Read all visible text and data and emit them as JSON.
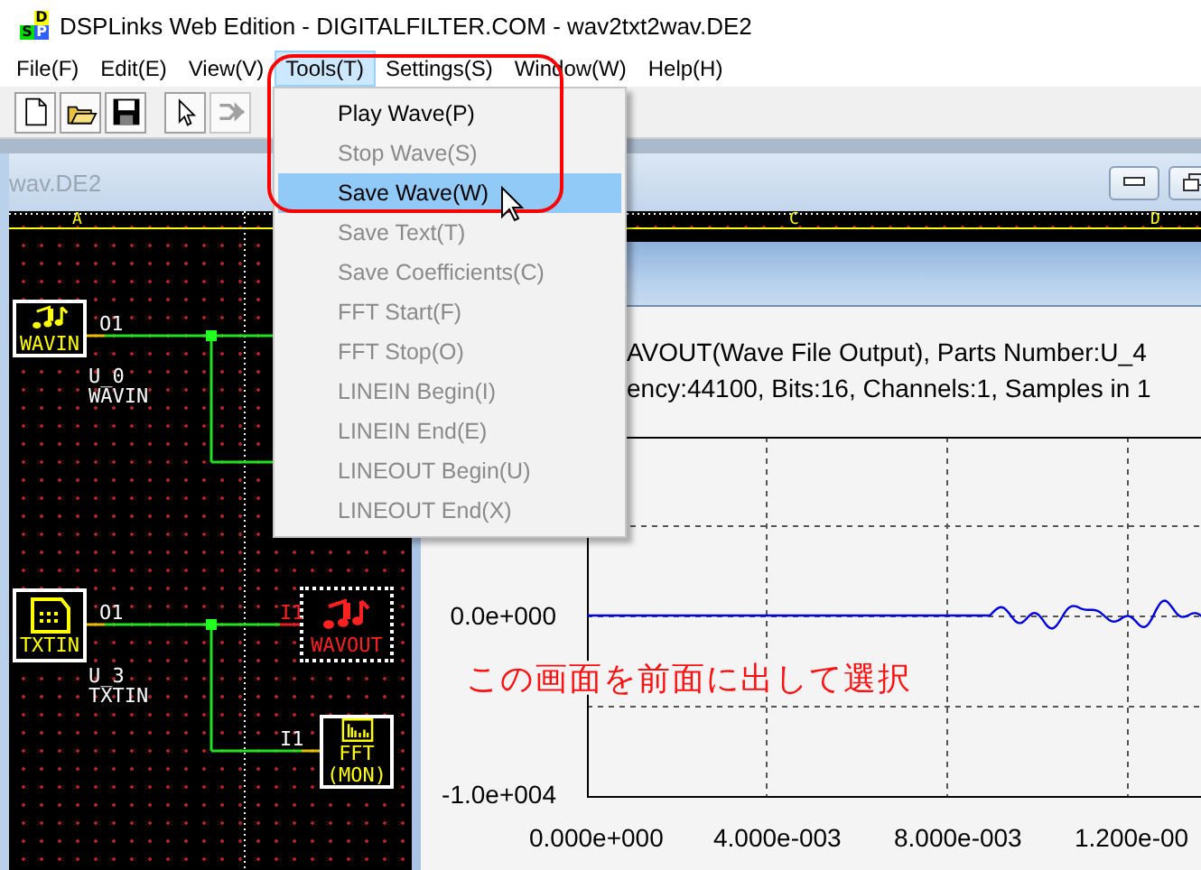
{
  "window": {
    "title": "DSPLinks Web Edition - DIGITALFILTER.COM - wav2txt2wav.DE2",
    "logo_letters": [
      "D",
      "S",
      "P"
    ]
  },
  "menu": [
    {
      "label": "File(F)",
      "selected": false
    },
    {
      "label": "Edit(E)",
      "selected": false
    },
    {
      "label": "View(V)",
      "selected": false
    },
    {
      "label": "Tools(T)",
      "selected": true
    },
    {
      "label": "Settings(S)",
      "selected": false
    },
    {
      "label": "Window(W)",
      "selected": false
    },
    {
      "label": "Help(H)",
      "selected": false
    }
  ],
  "toolbar": [
    {
      "kind": "new",
      "disabled": false
    },
    {
      "kind": "open",
      "disabled": false
    },
    {
      "kind": "save",
      "disabled": false
    },
    {
      "kind": "pointer",
      "disabled": false
    },
    {
      "kind": "wire",
      "disabled": true
    }
  ],
  "tools_menu": [
    {
      "label": "Play Wave(P)",
      "disabled": false,
      "selected": false
    },
    {
      "label": "Stop Wave(S)",
      "disabled": true,
      "selected": false
    },
    {
      "label": "Save Wave(W)",
      "disabled": false,
      "selected": true
    },
    {
      "label": "Save Text(T)",
      "disabled": true,
      "selected": false
    },
    {
      "label": "Save Coefficients(C)",
      "disabled": true,
      "selected": false
    },
    {
      "label": "FFT Start(F)",
      "disabled": true,
      "selected": false
    },
    {
      "label": "FFT Stop(O)",
      "disabled": true,
      "selected": false
    },
    {
      "label": "LINEIN Begin(I)",
      "disabled": true,
      "selected": false
    },
    {
      "label": "LINEIN End(E)",
      "disabled": true,
      "selected": false
    },
    {
      "label": "LINEOUT Begin(U)",
      "disabled": true,
      "selected": false
    },
    {
      "label": "LINEOUT End(X)",
      "disabled": true,
      "selected": false
    }
  ],
  "schematic": {
    "title": "wav.DE2",
    "columns": [
      "A",
      "C",
      "D"
    ],
    "parts": [
      {
        "kind": "wavin",
        "label": "WAVIN",
        "port": "O1",
        "id_label": "U_0",
        "name_label": "WAVIN",
        "selected": false
      },
      {
        "kind": "txtin",
        "label": "TXTIN",
        "port": "O1",
        "id_label": "U_3",
        "name_label": "TXTIN",
        "selected": false
      },
      {
        "kind": "wavout",
        "label": "WAVOUT",
        "port": "I1",
        "selected": true
      },
      {
        "kind": "fft",
        "label": "FFT",
        "sublabel": "(MON)",
        "port": "I1",
        "selected": false
      }
    ]
  },
  "wave_window": {
    "info_lines": [
      "AVOUT(Wave File Output), Parts Number:U_4",
      "ency:44100, Bits:16, Channels:1, Samples in 1"
    ],
    "y_tick_labels": [
      "0.0e+000",
      "-1.0e+004"
    ],
    "x_tick_labels": [
      "0.000e+000",
      "4.000e-003",
      "8.000e-003",
      "1.200e-00"
    ]
  },
  "annotation": "この画面を前面に出して選択"
}
